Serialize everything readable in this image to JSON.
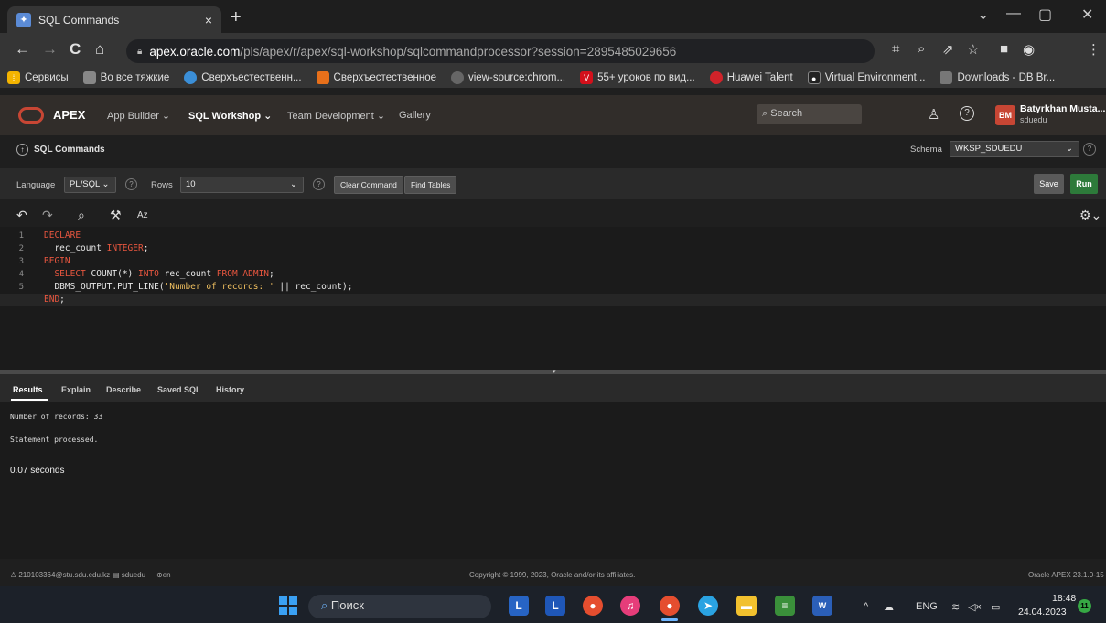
{
  "browser": {
    "tab_title": "SQL Commands",
    "tab_close": "×",
    "new_tab": "+",
    "url_host": "apex.oracle.com",
    "url_path": "/pls/apex/r/apex/sql-workshop/sqlcommandprocessor?session=2895485029656",
    "window_controls": [
      "⌄",
      "—",
      "▢",
      "✕"
    ],
    "bookmarks": [
      {
        "label": "Сервисы",
        "color": "#f4b400"
      },
      {
        "label": "Во все тяжкие",
        "color": "#888888"
      },
      {
        "label": "Сверхъестественн...",
        "color": "#3b8fd8"
      },
      {
        "label": "Сверхъестественное",
        "color": "#e8701a"
      },
      {
        "label": "view-source:chrom...",
        "color": "#666666"
      },
      {
        "label": "55+ уроков по вид...",
        "color": "#d3101b"
      },
      {
        "label": "Huawei Talent",
        "color": "#d0232a"
      },
      {
        "label": "Virtual Environment...",
        "color": "#222222"
      },
      {
        "label": "Downloads - DB Br...",
        "color": "#777777"
      }
    ]
  },
  "apex": {
    "brand": "APEX",
    "nav": [
      "App Builder",
      "SQL Workshop",
      "Team Development",
      "Gallery"
    ],
    "search_placeholder": "Search",
    "avatar_initials": "BM",
    "user_name": "Batyrkhan Musta...",
    "user_workspace": "sduedu",
    "breadcrumb": "SQL Commands",
    "schema_label": "Schema",
    "schema_value": "WKSP_SDUEDU",
    "language_label": "Language",
    "language_value": "PL/SQL",
    "rows_label": "Rows",
    "rows_value": "10",
    "clear_command": "Clear Command",
    "find_tables": "Find Tables",
    "save": "Save",
    "run": "Run"
  },
  "code_lines": [
    "DECLARE",
    "  rec_count INTEGER;",
    "BEGIN",
    "  SELECT COUNT(*) INTO rec_count FROM ADMIN;",
    "  DBMS_OUTPUT.PUT_LINE('Number of records: ' || rec_count);",
    "END;"
  ],
  "line_numbers": [
    "1",
    "2",
    "3",
    "4",
    "5",
    "6"
  ],
  "results_tabs": [
    "Results",
    "Explain",
    "Describe",
    "Saved SQL",
    "History"
  ],
  "results": {
    "output": "Number of records: 33",
    "status": "Statement processed.",
    "time": "0.07 seconds"
  },
  "footer": {
    "email": "210103364@stu.sdu.edu.kz",
    "workspace": "sduedu",
    "lang": "en",
    "copyright": "Copyright © 1999, 2023, Oracle and/or its affiliates.",
    "version": "Oracle APEX 23.1.0-15"
  },
  "taskbar": {
    "search": "Поиск",
    "lang": "ENG",
    "time": "18:48",
    "date": "24.04.2023",
    "notifications": "11"
  }
}
